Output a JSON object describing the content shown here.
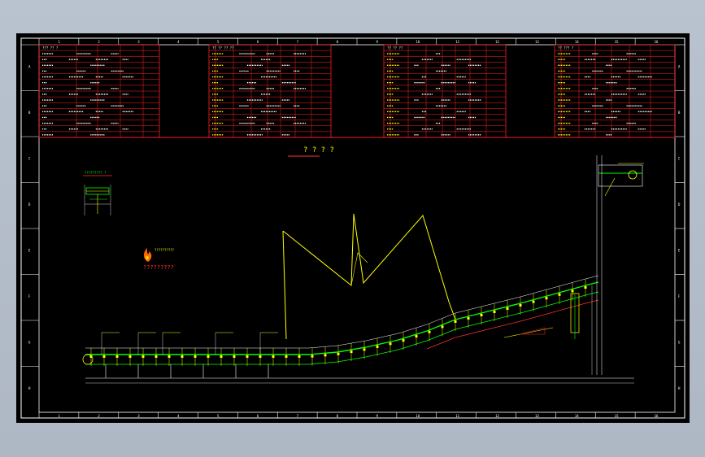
{
  "drawing": {
    "title": "? ? ? ?",
    "legend_note": "?????????",
    "detail_marker": "????????? ?",
    "logo_label": "??????????"
  },
  "border": {
    "top_ticks": [
      "1",
      "2",
      "3",
      "4",
      "5",
      "6",
      "7",
      "8",
      "9",
      "10",
      "11",
      "12",
      "13",
      "14",
      "15",
      "16"
    ],
    "side_ticks": [
      "A",
      "B",
      "C",
      "D",
      "E",
      "F",
      "G",
      "H"
    ]
  },
  "colors": {
    "background": "#000000",
    "frame": "#ffffff",
    "table_lines": "#ff2020",
    "geometry": "#ffff00",
    "belt": "#00ff00",
    "text": "#ffffff",
    "dimension": "#ff3030"
  },
  "tables": {
    "block1_header": "??? ?? ?",
    "block2_header": "?? ?? ?? ??",
    "block3_header": "?? ?? ??",
    "block4_header": "?? ??? ?"
  }
}
